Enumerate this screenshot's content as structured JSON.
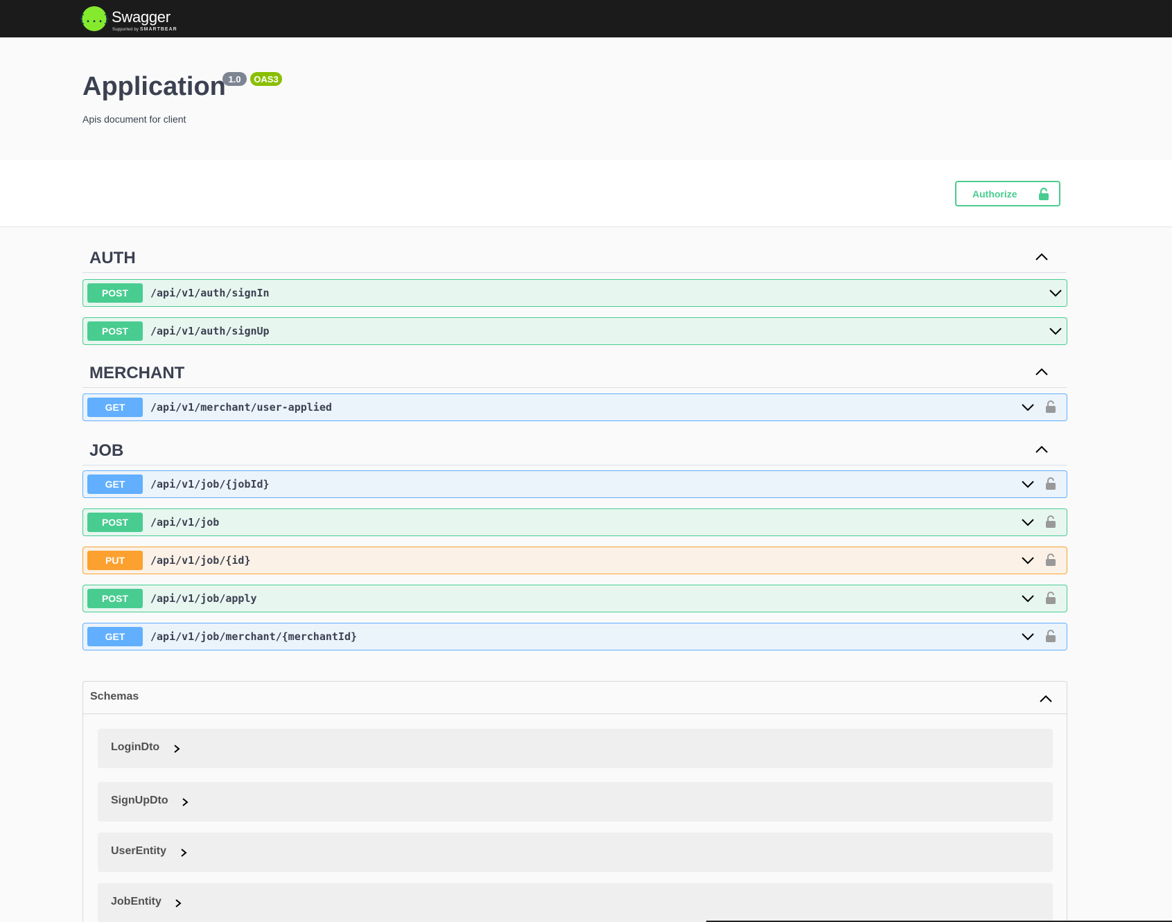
{
  "topbar": {
    "logo_symbol": "{...}",
    "brand": "Swagger",
    "supported_by": "Supported by",
    "company": "SMARTBEAR"
  },
  "info": {
    "title": "Application",
    "version": "1.0",
    "oas": "OAS3",
    "description": "Apis document for client"
  },
  "authorize": {
    "label": "Authorize",
    "icon": "lock-open-icon",
    "color": "#49cc90"
  },
  "tags": [
    {
      "name": "AUTH",
      "operations": [
        {
          "method": "POST",
          "path": "/api/v1/auth/signIn",
          "locked": false
        },
        {
          "method": "POST",
          "path": "/api/v1/auth/signUp",
          "locked": false
        }
      ]
    },
    {
      "name": "MERCHANT",
      "operations": [
        {
          "method": "GET",
          "path": "/api/v1/merchant/user-applied",
          "locked": true
        }
      ]
    },
    {
      "name": "JOB",
      "operations": [
        {
          "method": "GET",
          "path": "/api/v1/job/{jobId}",
          "locked": true
        },
        {
          "method": "POST",
          "path": "/api/v1/job",
          "locked": true
        },
        {
          "method": "PUT",
          "path": "/api/v1/job/{id}",
          "locked": true
        },
        {
          "method": "POST",
          "path": "/api/v1/job/apply",
          "locked": true
        },
        {
          "method": "GET",
          "path": "/api/v1/job/merchant/{merchantId}",
          "locked": true
        }
      ]
    }
  ],
  "schemas": {
    "title": "Schemas",
    "items": [
      "LoginDto",
      "SignUpDto",
      "UserEntity",
      "JobEntity"
    ]
  },
  "colors": {
    "post": "#49cc90",
    "get": "#61affe",
    "put": "#fca130",
    "topbar": "#1b1b1b",
    "logo": "#85ea2d"
  }
}
